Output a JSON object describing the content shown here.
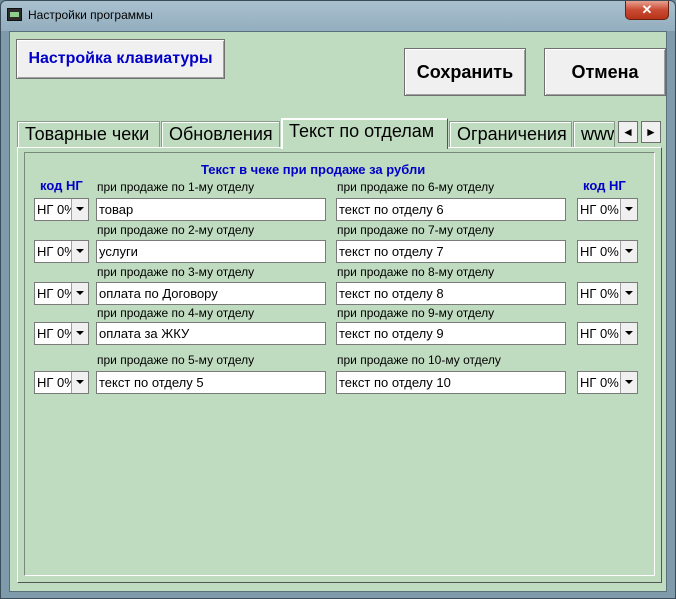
{
  "window": {
    "title": "Настройки программы",
    "close_glyph": "✕"
  },
  "toolbar": {
    "keyboard_label": "Настройка клавиатуры",
    "save_label": "Сохранить",
    "cancel_label": "Отмена"
  },
  "tabs": [
    {
      "label": "Товарные чеки",
      "active": false
    },
    {
      "label": "Обновления",
      "active": false
    },
    {
      "label": "Текст по отделам",
      "active": true
    },
    {
      "label": "Ограничения",
      "active": false
    },
    {
      "label": "www",
      "active": false
    }
  ],
  "tab_scroll": {
    "left_glyph": "◄",
    "right_glyph": "►"
  },
  "panel": {
    "caption": "Текст в чеке при продаже за рубли",
    "left_ng_header": "код НГ",
    "right_ng_header": "код НГ",
    "left_rows": [
      {
        "label": "при продаже по 1-му отделу",
        "value": "товар",
        "ng": "НГ 0%"
      },
      {
        "label": "при продаже по 2-му отделу",
        "value": "услуги",
        "ng": "НГ 0%"
      },
      {
        "label": "при продаже по 3-му отделу",
        "value": "оплата по Договору",
        "ng": "НГ 0%"
      },
      {
        "label": "при продаже по 4-му отделу",
        "value": "оплата за ЖКУ",
        "ng": "НГ 0%"
      },
      {
        "label": "при продаже по 5-му отделу",
        "value": "текст по отделу 5",
        "ng": "НГ 0%"
      }
    ],
    "right_rows": [
      {
        "label": "при продаже по 6-му отделу",
        "value": "текст по отделу 6",
        "ng": "НГ 0%"
      },
      {
        "label": "при продаже по 7-му отделу",
        "value": "текст по отделу 7",
        "ng": "НГ 0%"
      },
      {
        "label": "при продаже по 8-му отделу",
        "value": "текст по отделу 8",
        "ng": "НГ 0%"
      },
      {
        "label": "при продаже по 9-му отделу",
        "value": "текст по отделу 9",
        "ng": "НГ 0%"
      },
      {
        "label": "при продаже по 10-му отделу",
        "value": "текст по отделу 10",
        "ng": "НГ 0%"
      }
    ]
  }
}
